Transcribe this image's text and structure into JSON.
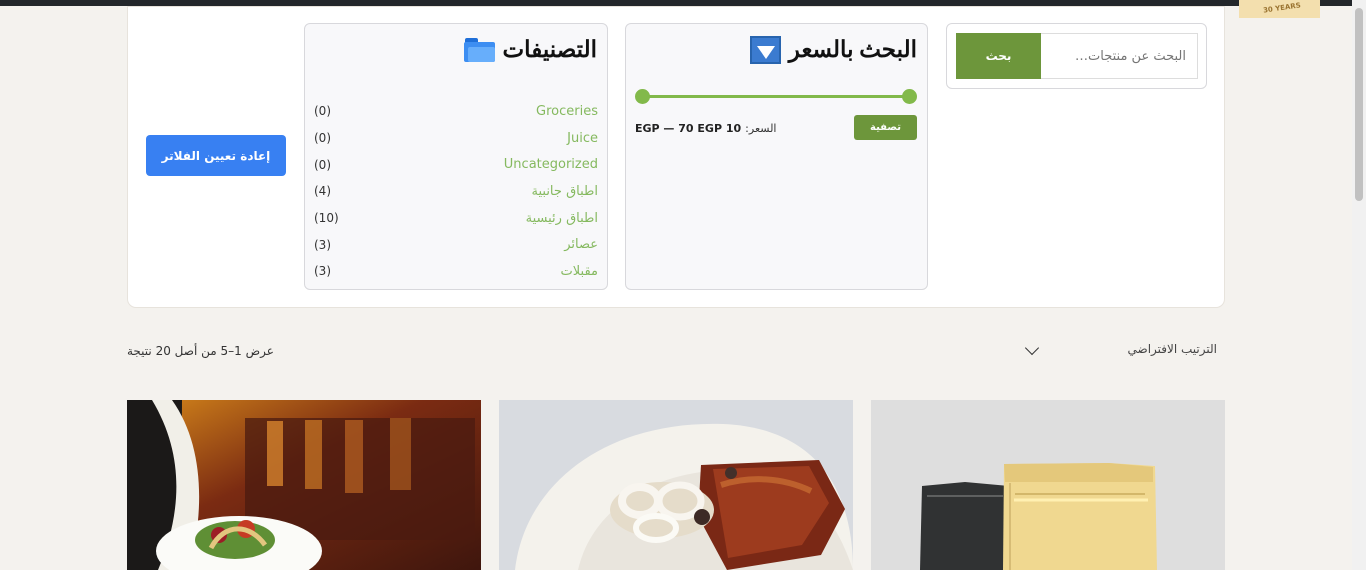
{
  "search": {
    "placeholder": "البحث عن منتجات…",
    "button_label": "بحث"
  },
  "price_filter": {
    "title": "البحث بالسعر",
    "label": "السعر:",
    "range_text": "10 EGP — 70 EGP",
    "min": 10,
    "max": 70,
    "currency": "EGP",
    "filter_button_label": "تصفية"
  },
  "categories": {
    "title": "التصنيفات",
    "items": [
      {
        "name": "Groceries",
        "count": "(0)"
      },
      {
        "name": "Juice",
        "count": "(0)"
      },
      {
        "name": "Uncategorized",
        "count": "(0)"
      },
      {
        "name": "اطباق جانبية",
        "count": "(4)"
      },
      {
        "name": "اطباق رئيسية",
        "count": "(10)"
      },
      {
        "name": "عصائر",
        "count": "(3)"
      },
      {
        "name": "مقبلات",
        "count": "(3)"
      }
    ]
  },
  "reset_button_label": "إعادة تعيين الفلاتر",
  "sort": {
    "selected": "الترتيب الافتراضي"
  },
  "results": {
    "text": "عرض 1–5 من أصل 20 نتيجة"
  },
  "logo": {
    "text": "30 YEARS"
  },
  "colors": {
    "accent_green": "#6d963b",
    "category_link": "#85b95f",
    "reset_blue": "#3880f2",
    "slider_green": "#82b94a"
  },
  "icons": {
    "price_filter": "funnel-icon",
    "categories": "folder-icon",
    "sort": "chevron-down-icon"
  },
  "products": [
    {
      "image": "restaurant-server-salad-photo"
    },
    {
      "image": "grilled-steak-plate-photo"
    },
    {
      "image": "black-and-gold-pouch-packaging-photo"
    }
  ]
}
